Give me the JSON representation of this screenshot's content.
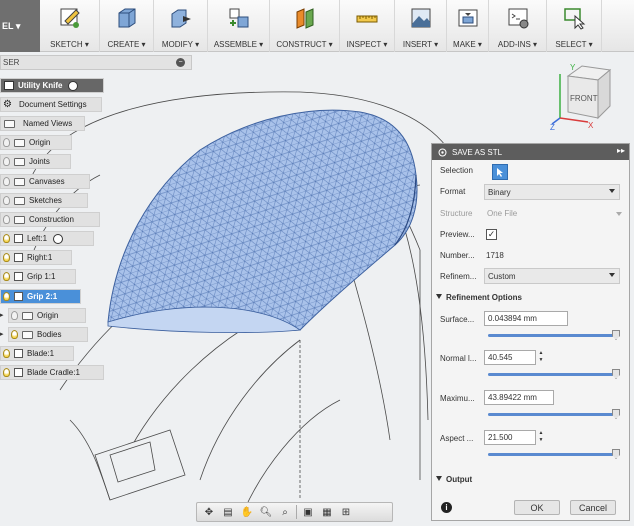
{
  "toolbar": {
    "workspace_label": "EL ▾",
    "groups": [
      {
        "label": "SKETCH ▾",
        "icon": "sketch-icon"
      },
      {
        "label": "CREATE ▾",
        "icon": "create-box-icon"
      },
      {
        "label": "MODIFY ▾",
        "icon": "modify-icon"
      },
      {
        "label": "ASSEMBLE ▾",
        "icon": "assemble-icon"
      },
      {
        "label": "CONSTRUCT ▾",
        "icon": "construct-plane-icon"
      },
      {
        "label": "INSPECT ▾",
        "icon": "measure-icon"
      },
      {
        "label": "INSERT ▾",
        "icon": "insert-image-icon"
      },
      {
        "label": "MAKE ▾",
        "icon": "3d-print-icon"
      },
      {
        "label": "ADD-INS ▾",
        "icon": "scripts-icon"
      },
      {
        "label": "SELECT ▾",
        "icon": "select-arrow-icon"
      }
    ]
  },
  "browser": {
    "header": "SER",
    "nodes": [
      {
        "label": "Utility Knife"
      },
      {
        "label": "Document Settings"
      },
      {
        "label": "Named Views"
      },
      {
        "label": "Origin"
      },
      {
        "label": "Joints"
      },
      {
        "label": "Canvases"
      },
      {
        "label": "Sketches"
      },
      {
        "label": "Construction"
      },
      {
        "label": "Left:1"
      },
      {
        "label": "Right:1"
      },
      {
        "label": "Grip 1:1"
      },
      {
        "label": "Grip 2:1"
      },
      {
        "label": "Origin"
      },
      {
        "label": "Bodies"
      },
      {
        "label": "Blade:1"
      },
      {
        "label": "Blade Cradle:1"
      }
    ]
  },
  "viewcube": {
    "face": "FRONT",
    "axes": [
      "Y",
      "Z",
      "X"
    ]
  },
  "stl_dialog": {
    "title": "SAVE AS STL",
    "selection_label": "Selection",
    "format_label": "Format",
    "format_value": "Binary",
    "structure_label": "Structure",
    "structure_value": "One File",
    "preview_label": "Preview...",
    "preview_checked": true,
    "number_label": "Number...",
    "number_value": "1718",
    "refinement_label": "Refinem...",
    "refinement_value": "Custom",
    "refinement_options_title": "Refinement Options",
    "surface_label": "Surface...",
    "surface_value": "0.043894 mm",
    "normal_label": "Normal l...",
    "normal_value": "40.545",
    "maximum_label": "Maximu...",
    "maximum_value": "43.89422 mm",
    "aspect_label": "Aspect ...",
    "aspect_value": "21.500",
    "output_title": "Output",
    "ok_label": "OK",
    "cancel_label": "Cancel",
    "slider_levels": {
      "surface": 1.0,
      "normal": 1.0,
      "maximum": 1.0,
      "aspect": 1.0
    }
  },
  "navbar": {
    "icons": [
      "orbit-icon",
      "look-at-icon",
      "pan-hand-icon",
      "zoom-icon",
      "fit-zoom-icon",
      "display-mode-icon",
      "grid-icon",
      "viewports-icon"
    ]
  },
  "colors": {
    "mesh_fill": "#a9c2ea",
    "mesh_line": "#3b5f9e",
    "active_node": "#4a90d9",
    "dialog_title": "#5d5d5d",
    "slider": "#5a8ad0"
  }
}
